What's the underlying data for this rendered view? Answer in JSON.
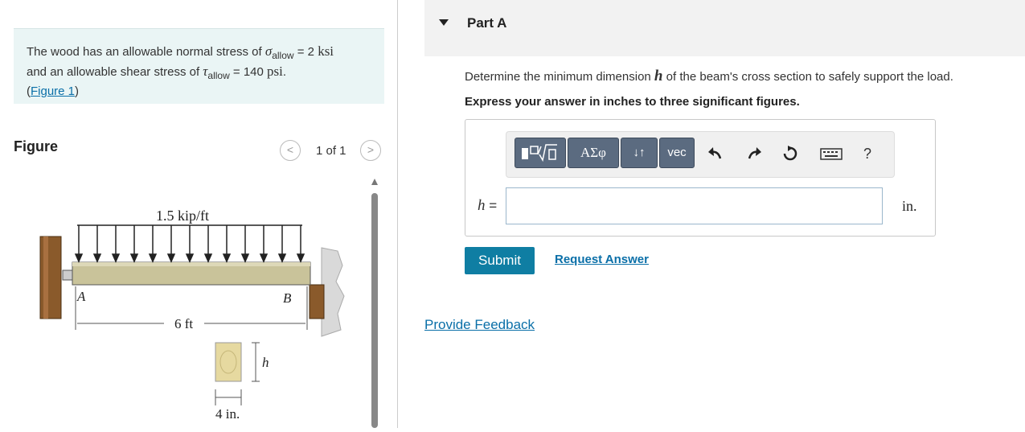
{
  "problem": {
    "line1_prefix": "The wood has an allowable normal stress of ",
    "sigma": "σ",
    "sigma_sub": "allow",
    "line1_value": " = 2 ",
    "line1_unit": "ksi",
    "line2_prefix": "and an allowable shear stress of ",
    "tau": "τ",
    "tau_sub": "allow",
    "line2_value": " = 140 ",
    "line2_unit": "psi",
    "line2_end": ".",
    "figure_link": "Figure 1",
    "paren_open": "(",
    "paren_close": ")"
  },
  "figure_panel": {
    "label": "Figure",
    "pager_text": "1 of 1",
    "prev": "<",
    "next": ">"
  },
  "diagram": {
    "load_label": "1.5 kip/ft",
    "point_a": "A",
    "point_b": "B",
    "span_label": "6 ft",
    "h_label": "h",
    "width_label": "4 in."
  },
  "part": {
    "title": "Part A",
    "question_prefix": "Determine the minimum dimension ",
    "question_var": "h",
    "question_suffix": " of the beam's cross section to safely support the load.",
    "instruction": "Express your answer in inches to three significant figures."
  },
  "toolbar": {
    "templates_icon": "templates-icon",
    "greek": "ΑΣφ",
    "arrows": "↓↑",
    "vec": "vec",
    "help": "?"
  },
  "answer": {
    "var": "h",
    "equals": " =",
    "value": "",
    "unit": "in."
  },
  "actions": {
    "submit": "Submit",
    "request": "Request Answer",
    "feedback": "Provide Feedback"
  },
  "colors": {
    "accent": "#0f7ea3",
    "link": "#0a6fa8",
    "problem_bg": "#eaf5f5",
    "toolbar_btn": "#5b6b80"
  }
}
